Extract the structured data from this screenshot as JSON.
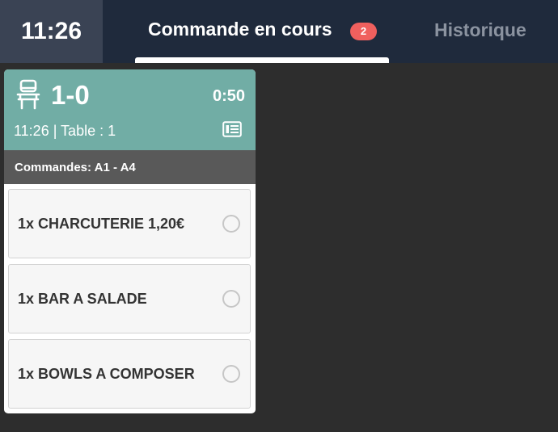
{
  "header": {
    "clock": "11:26",
    "tabs": {
      "current": {
        "label": "Commande en cours",
        "badge": "2"
      },
      "history": {
        "label": "Historique"
      }
    }
  },
  "order_card": {
    "table_label": "1-0",
    "elapsed": "0:50",
    "subline": "11:26 | Table : 1",
    "orders_range": "Commandes: A1 - A4",
    "header_color": "#71ada5",
    "icons": {
      "seat": "chair-icon",
      "ticket": "ticket-icon",
      "item_status": "circle-icon"
    },
    "items": [
      {
        "text": "1x CHARCUTERIE 1,20€"
      },
      {
        "text": "1x BAR A SALADE"
      },
      {
        "text": "1x BOWLS A COMPOSER"
      }
    ]
  }
}
